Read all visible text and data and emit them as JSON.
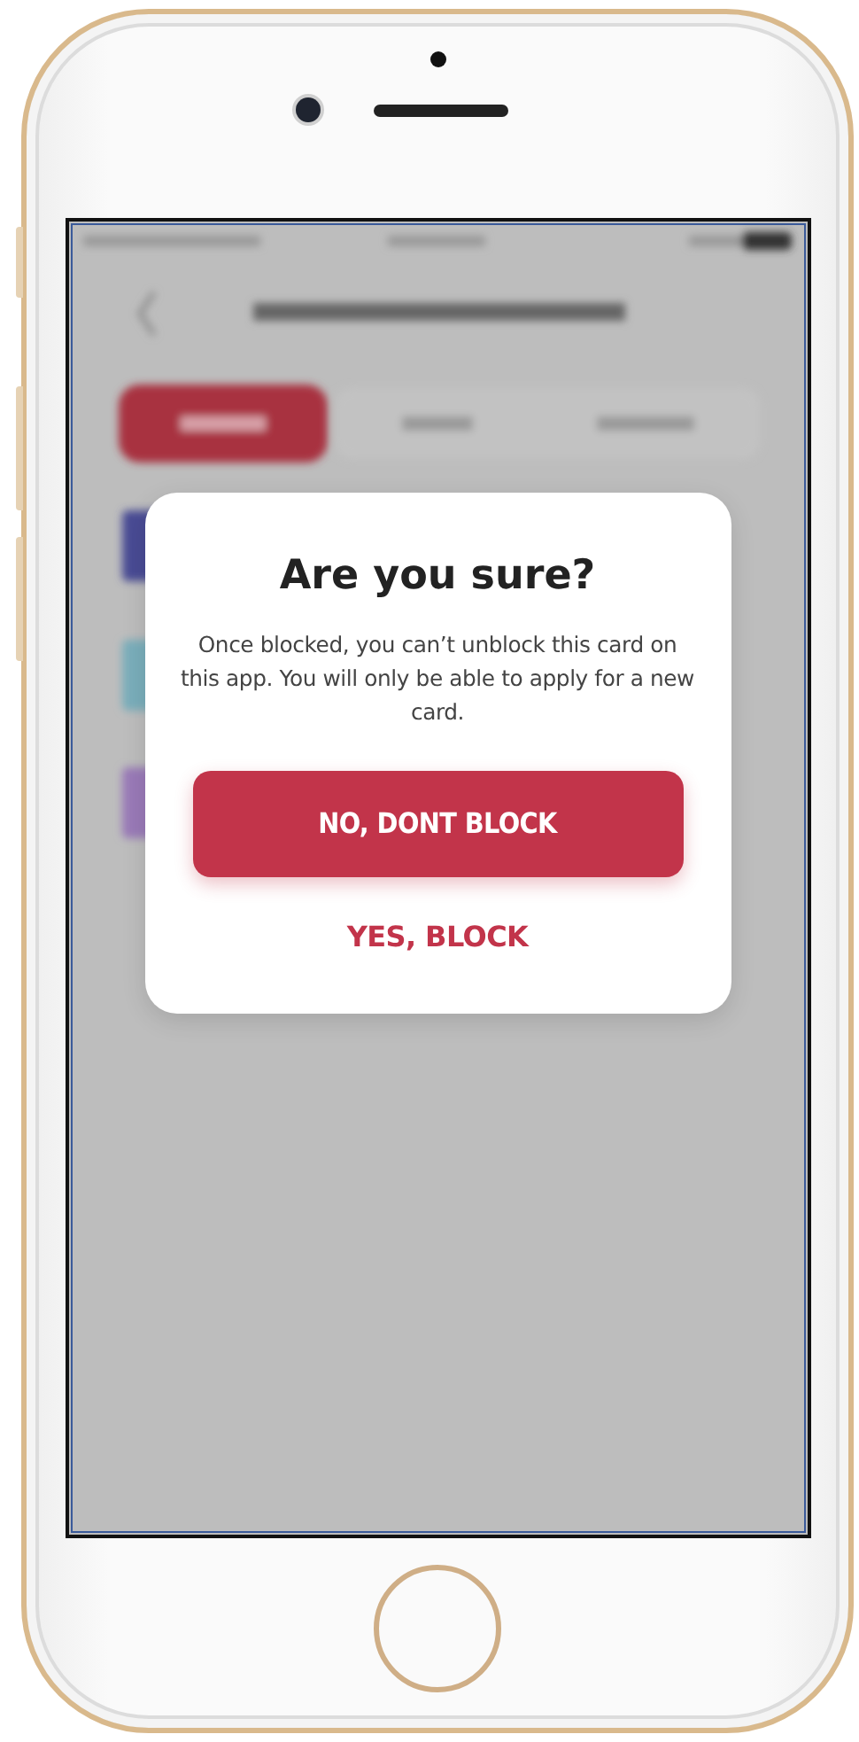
{
  "dialog": {
    "title": "Are you sure?",
    "message": "Once blocked, you can’t unblock this card on this app. You will only be able to apply for a new card.",
    "buttons": [
      {
        "label": "NO, DONT BLOCK",
        "kind": "primary"
      },
      {
        "label": "YES, BLOCK",
        "kind": "text"
      }
    ]
  }
}
